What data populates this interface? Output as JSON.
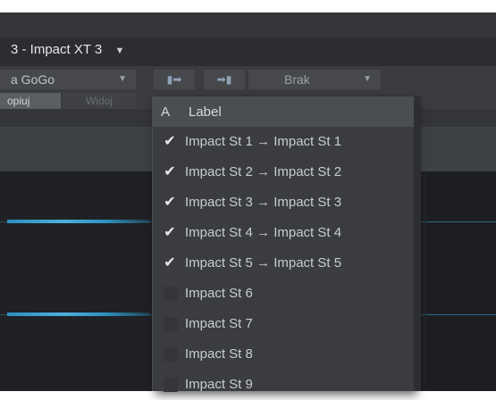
{
  "header": {
    "track_title": "3 - Impact XT 3",
    "track_dropdown_icon": "caret-down-icon"
  },
  "toolbar": {
    "preset_value": "a GoGo",
    "copy_label": "opiuj",
    "view_label": "Widoj",
    "input_icon": "route-in-icon",
    "output_icon": "route-out-icon",
    "routing_value": "Brak"
  },
  "dropdown": {
    "sort_label": "A",
    "column_label": "Label",
    "items": [
      {
        "label": "Impact St 1 → Impact St 1",
        "checked": true
      },
      {
        "label": "Impact St 2 → Impact St 2",
        "checked": true
      },
      {
        "label": "Impact St 3 → Impact St 3",
        "checked": true
      },
      {
        "label": "Impact St 4 → Impact St 4",
        "checked": true
      },
      {
        "label": "Impact St 5 → Impact St 5",
        "checked": true
      },
      {
        "label": "Impact St 6",
        "checked": false
      },
      {
        "label": "Impact St 7",
        "checked": false
      },
      {
        "label": "Impact St 8",
        "checked": false
      },
      {
        "label": "Impact St 9",
        "checked": false
      }
    ]
  },
  "colors": {
    "accent_wave": "#2c8fbf",
    "panel_bg": "#3a3c40",
    "header_bg": "#4a4d52"
  }
}
